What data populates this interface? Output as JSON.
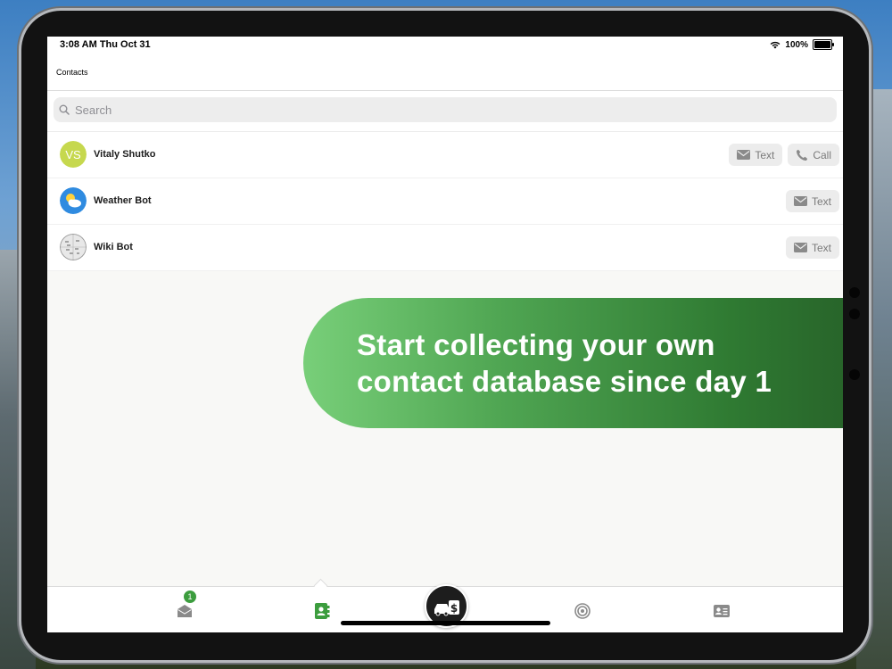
{
  "status_bar": {
    "time": "3:08 AM Thu Oct 31",
    "battery": "100%",
    "battery_level": 1.0
  },
  "nav": {
    "title": "Contacts"
  },
  "search": {
    "placeholder": "Search"
  },
  "contacts": [
    {
      "name": "Vitaly Shutko",
      "initials": "VS",
      "avatar_color": "#c6d84e",
      "actions": [
        "Text",
        "Call"
      ]
    },
    {
      "name": "Weather Bot",
      "avatar_icon": "weather-cloud-icon",
      "actions": [
        "Text"
      ]
    },
    {
      "name": "Wiki Bot",
      "avatar_icon": "wikipedia-globe-icon",
      "actions": [
        "Text"
      ]
    }
  ],
  "promo": {
    "line1": "Start collecting your own",
    "line2": "contact database since day 1"
  },
  "tab_bar": {
    "inbox_badge": "1",
    "tabs": [
      "inbox-icon",
      "contacts-icon",
      "dealer-icon",
      "radar-icon",
      "id-card-icon"
    ]
  },
  "colors": {
    "accent_green": "#3c9d3e",
    "promo_start": "#78cf79",
    "promo_end": "#265f28"
  }
}
